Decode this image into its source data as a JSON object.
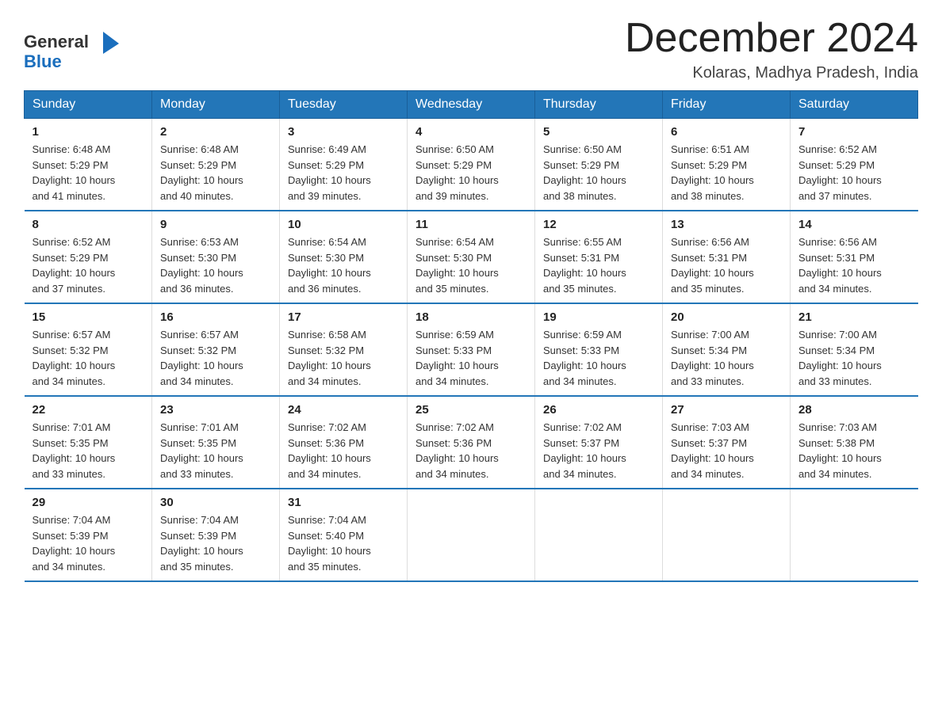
{
  "header": {
    "logo_general": "General",
    "logo_blue": "Blue",
    "month_title": "December 2024",
    "location": "Kolaras, Madhya Pradesh, India"
  },
  "weekdays": [
    "Sunday",
    "Monday",
    "Tuesday",
    "Wednesday",
    "Thursday",
    "Friday",
    "Saturday"
  ],
  "weeks": [
    [
      {
        "day": "1",
        "info": "Sunrise: 6:48 AM\nSunset: 5:29 PM\nDaylight: 10 hours\nand 41 minutes."
      },
      {
        "day": "2",
        "info": "Sunrise: 6:48 AM\nSunset: 5:29 PM\nDaylight: 10 hours\nand 40 minutes."
      },
      {
        "day": "3",
        "info": "Sunrise: 6:49 AM\nSunset: 5:29 PM\nDaylight: 10 hours\nand 39 minutes."
      },
      {
        "day": "4",
        "info": "Sunrise: 6:50 AM\nSunset: 5:29 PM\nDaylight: 10 hours\nand 39 minutes."
      },
      {
        "day": "5",
        "info": "Sunrise: 6:50 AM\nSunset: 5:29 PM\nDaylight: 10 hours\nand 38 minutes."
      },
      {
        "day": "6",
        "info": "Sunrise: 6:51 AM\nSunset: 5:29 PM\nDaylight: 10 hours\nand 38 minutes."
      },
      {
        "day": "7",
        "info": "Sunrise: 6:52 AM\nSunset: 5:29 PM\nDaylight: 10 hours\nand 37 minutes."
      }
    ],
    [
      {
        "day": "8",
        "info": "Sunrise: 6:52 AM\nSunset: 5:29 PM\nDaylight: 10 hours\nand 37 minutes."
      },
      {
        "day": "9",
        "info": "Sunrise: 6:53 AM\nSunset: 5:30 PM\nDaylight: 10 hours\nand 36 minutes."
      },
      {
        "day": "10",
        "info": "Sunrise: 6:54 AM\nSunset: 5:30 PM\nDaylight: 10 hours\nand 36 minutes."
      },
      {
        "day": "11",
        "info": "Sunrise: 6:54 AM\nSunset: 5:30 PM\nDaylight: 10 hours\nand 35 minutes."
      },
      {
        "day": "12",
        "info": "Sunrise: 6:55 AM\nSunset: 5:31 PM\nDaylight: 10 hours\nand 35 minutes."
      },
      {
        "day": "13",
        "info": "Sunrise: 6:56 AM\nSunset: 5:31 PM\nDaylight: 10 hours\nand 35 minutes."
      },
      {
        "day": "14",
        "info": "Sunrise: 6:56 AM\nSunset: 5:31 PM\nDaylight: 10 hours\nand 34 minutes."
      }
    ],
    [
      {
        "day": "15",
        "info": "Sunrise: 6:57 AM\nSunset: 5:32 PM\nDaylight: 10 hours\nand 34 minutes."
      },
      {
        "day": "16",
        "info": "Sunrise: 6:57 AM\nSunset: 5:32 PM\nDaylight: 10 hours\nand 34 minutes."
      },
      {
        "day": "17",
        "info": "Sunrise: 6:58 AM\nSunset: 5:32 PM\nDaylight: 10 hours\nand 34 minutes."
      },
      {
        "day": "18",
        "info": "Sunrise: 6:59 AM\nSunset: 5:33 PM\nDaylight: 10 hours\nand 34 minutes."
      },
      {
        "day": "19",
        "info": "Sunrise: 6:59 AM\nSunset: 5:33 PM\nDaylight: 10 hours\nand 34 minutes."
      },
      {
        "day": "20",
        "info": "Sunrise: 7:00 AM\nSunset: 5:34 PM\nDaylight: 10 hours\nand 33 minutes."
      },
      {
        "day": "21",
        "info": "Sunrise: 7:00 AM\nSunset: 5:34 PM\nDaylight: 10 hours\nand 33 minutes."
      }
    ],
    [
      {
        "day": "22",
        "info": "Sunrise: 7:01 AM\nSunset: 5:35 PM\nDaylight: 10 hours\nand 33 minutes."
      },
      {
        "day": "23",
        "info": "Sunrise: 7:01 AM\nSunset: 5:35 PM\nDaylight: 10 hours\nand 33 minutes."
      },
      {
        "day": "24",
        "info": "Sunrise: 7:02 AM\nSunset: 5:36 PM\nDaylight: 10 hours\nand 34 minutes."
      },
      {
        "day": "25",
        "info": "Sunrise: 7:02 AM\nSunset: 5:36 PM\nDaylight: 10 hours\nand 34 minutes."
      },
      {
        "day": "26",
        "info": "Sunrise: 7:02 AM\nSunset: 5:37 PM\nDaylight: 10 hours\nand 34 minutes."
      },
      {
        "day": "27",
        "info": "Sunrise: 7:03 AM\nSunset: 5:37 PM\nDaylight: 10 hours\nand 34 minutes."
      },
      {
        "day": "28",
        "info": "Sunrise: 7:03 AM\nSunset: 5:38 PM\nDaylight: 10 hours\nand 34 minutes."
      }
    ],
    [
      {
        "day": "29",
        "info": "Sunrise: 7:04 AM\nSunset: 5:39 PM\nDaylight: 10 hours\nand 34 minutes."
      },
      {
        "day": "30",
        "info": "Sunrise: 7:04 AM\nSunset: 5:39 PM\nDaylight: 10 hours\nand 35 minutes."
      },
      {
        "day": "31",
        "info": "Sunrise: 7:04 AM\nSunset: 5:40 PM\nDaylight: 10 hours\nand 35 minutes."
      },
      {
        "day": "",
        "info": ""
      },
      {
        "day": "",
        "info": ""
      },
      {
        "day": "",
        "info": ""
      },
      {
        "day": "",
        "info": ""
      }
    ]
  ]
}
